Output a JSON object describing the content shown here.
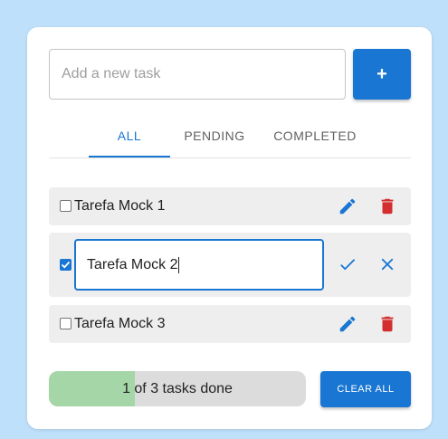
{
  "new_task": {
    "placeholder": "Add a new task",
    "add_label": "+"
  },
  "tabs": [
    {
      "label": "ALL",
      "active": true
    },
    {
      "label": "PENDING",
      "active": false
    },
    {
      "label": "COMPLETED",
      "active": false
    }
  ],
  "tasks": [
    {
      "text": "Tarefa Mock 1",
      "done": false,
      "editing": false,
      "actions": [
        "pencil-icon",
        "trash-icon"
      ]
    },
    {
      "text": "Tarefa Mock 2",
      "done": true,
      "editing": true,
      "actions": [
        "check-icon",
        "close-icon"
      ]
    },
    {
      "text": "Tarefa Mock 3",
      "done": false,
      "editing": false,
      "actions": [
        "pencil-icon",
        "trash-icon"
      ]
    }
  ],
  "progress": {
    "label": "1 of 3 tasks done",
    "fraction": 0.333
  },
  "clear_label": "CLEAR ALL",
  "colors": {
    "accent": "#1976d2",
    "delete": "#d32f2f",
    "progress_fill": "#a5d6a7",
    "background": "#bfe0fa"
  }
}
